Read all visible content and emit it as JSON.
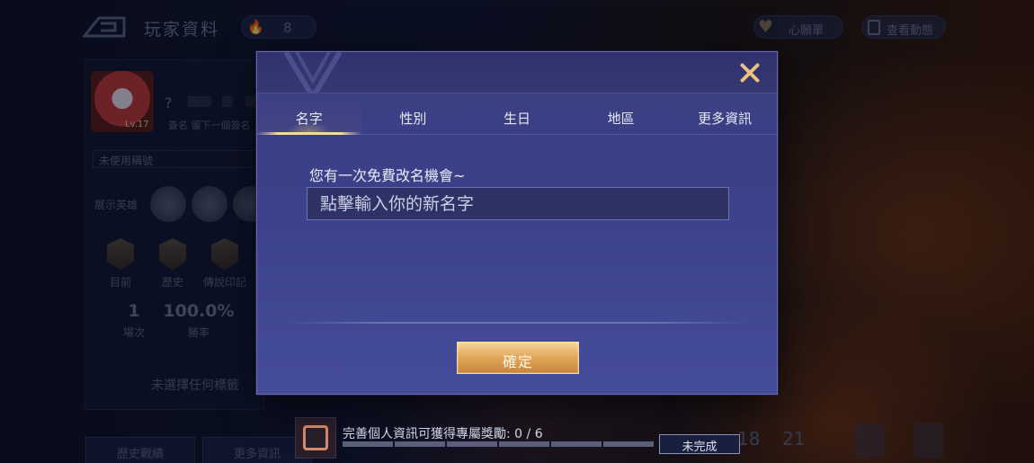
{
  "header": {
    "title": "玩家資料",
    "heat_value": "8",
    "wishlist_label": "心願單",
    "dynamics_label": "查看動態"
  },
  "profile": {
    "level": "Lv.17",
    "name_placeholder": "?",
    "sign_text": "簽名 留下一個簽名",
    "title_field": "未使用稱號",
    "heroes_label": "展示英雄",
    "badges": [
      "目前",
      "歷史",
      "傳說印記"
    ],
    "stats": [
      {
        "value": "1",
        "label": "場次"
      },
      {
        "value": "100.0%",
        "label": "勝率"
      }
    ],
    "no_tag": "未選擇任何標籤",
    "bottom_buttons": [
      "歷史戰績",
      "更多資訊"
    ],
    "right_stats": [
      "18",
      "21"
    ]
  },
  "reward": {
    "text": "完善個人資訊可獲得專屬獎勵: 0 / 6",
    "progress": 0,
    "status_button": "未完成"
  },
  "modal": {
    "tabs": [
      "名字",
      "性別",
      "生日",
      "地區",
      "更多資訊"
    ],
    "active_tab": 0,
    "hint": "您有一次免費改名機會~",
    "input_placeholder": "點擊輸入你的新名字",
    "input_value": "",
    "confirm_label": "確定"
  },
  "colors": {
    "modal_bg": "#3b418a",
    "accent_gold": "#f0c07a",
    "confirm_btn": "#e0a65a"
  }
}
